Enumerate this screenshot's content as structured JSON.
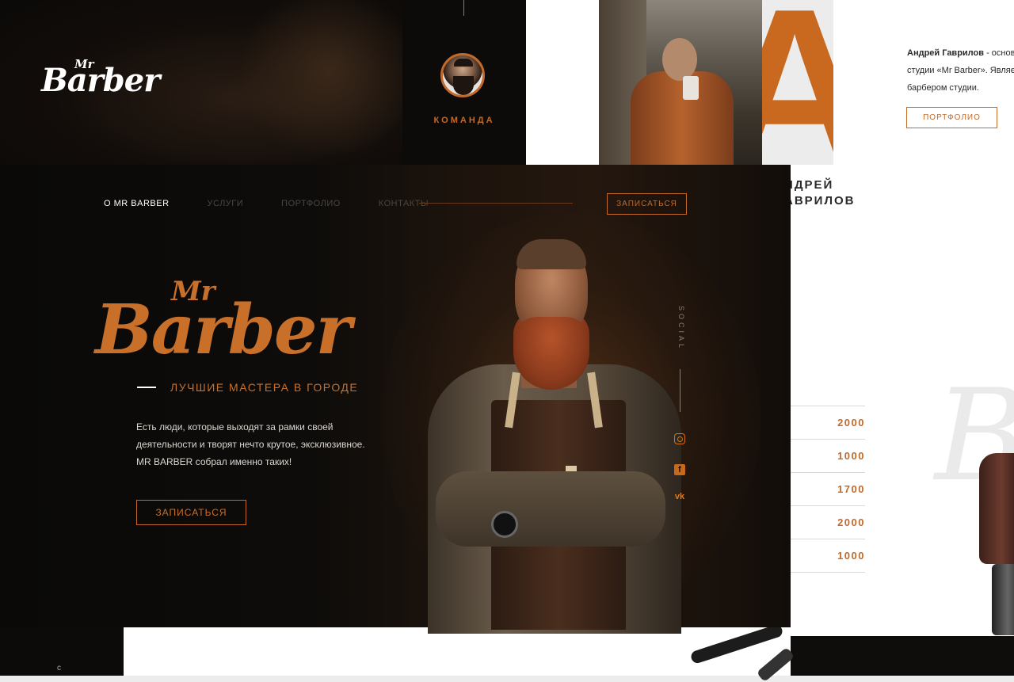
{
  "top_left": {
    "logo_mr": "Mr",
    "logo_barber": "Barber"
  },
  "team": {
    "label": "КОМАНДА"
  },
  "big_letter": "А",
  "bio": {
    "name": "Андрей Гаврилов",
    "line1_rest": " - основ",
    "line2": "студии «Mr Barber». Являет",
    "line3": "барбером студии."
  },
  "portfolio_button": "ПОРТФОЛИО",
  "name_heading": {
    "line1": "НДРЕЙ",
    "line2": "АВРИЛОВ"
  },
  "prices": [
    "2000",
    "1000",
    "1700",
    "2000",
    "1000"
  ],
  "watermark": "B",
  "bottom_char": "с",
  "hero": {
    "nav": [
      {
        "label": "О MR BARBER",
        "active": true
      },
      {
        "label": "УСЛУГИ",
        "active": false
      },
      {
        "label": "ПОРТФОЛИО",
        "active": false
      },
      {
        "label": "КОНТАКТЫ",
        "active": false
      }
    ],
    "signup_top": "ЗАПИСАТЬСЯ",
    "logo_mr": "Mr",
    "logo_barber": "Barber",
    "tagline": "ЛУЧШИЕ МАСТЕРА В ГОРОДЕ",
    "desc_line1": "Есть люди, которые выходят за рамки своей",
    "desc_line2": "деятельности и творят нечто крутое, эксклюзивное.",
    "desc_line3": "MR BARBER собрал именно таких!",
    "signup_button": "ЗАПИСАТЬСЯ",
    "social_label": "SOCIAL",
    "social_icons": [
      "instagram-icon",
      "facebook-icon",
      "vk-icon"
    ],
    "vk_text": "vk",
    "fb_text": "f"
  },
  "colors": {
    "accent": "#c26a2a",
    "dark": "#0d0b0a",
    "white": "#ffffff"
  }
}
